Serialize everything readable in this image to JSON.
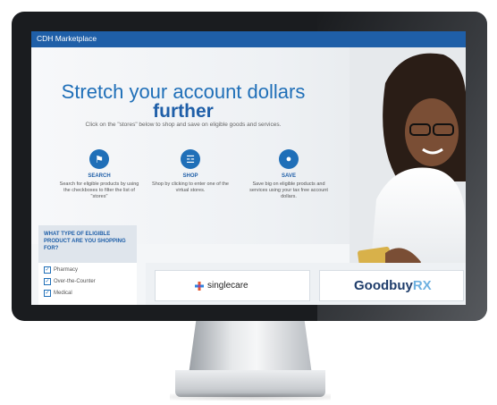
{
  "app": {
    "title": "CDH Marketplace"
  },
  "hero": {
    "headline": "Stretch your account dollars",
    "headline_emphasis": "further",
    "subtitle": "Click on the \"stores\" below to shop and save on eligible goods and services."
  },
  "steps": [
    {
      "title": "SEARCH",
      "text": "Search for eligible products by using the checkboxes to filter the list of \"stores\"",
      "icon": "tag-icon"
    },
    {
      "title": "SHOP",
      "text": "Shop by clicking to enter one of the virtual stores.",
      "icon": "basket-icon"
    },
    {
      "title": "SAVE",
      "text": "Save big on eligible products and services using your tax free account dollars.",
      "icon": "piggy-bank-icon"
    }
  ],
  "sidebar": {
    "heading": "WHAT TYPE OF ELIGIBLE PRODUCT ARE YOU SHOPPING FOR?",
    "filters": [
      {
        "label": "Pharmacy",
        "checked": true
      },
      {
        "label": "Over-the-Counter",
        "checked": true
      },
      {
        "label": "Medical",
        "checked": true
      }
    ]
  },
  "stores": {
    "store1": {
      "name": "singlecare"
    },
    "store2": {
      "name_main": "Goodbuy",
      "name_accent": "RX"
    }
  },
  "colors": {
    "accent": "#1f6fb8",
    "topbar": "#1f5fa8"
  }
}
